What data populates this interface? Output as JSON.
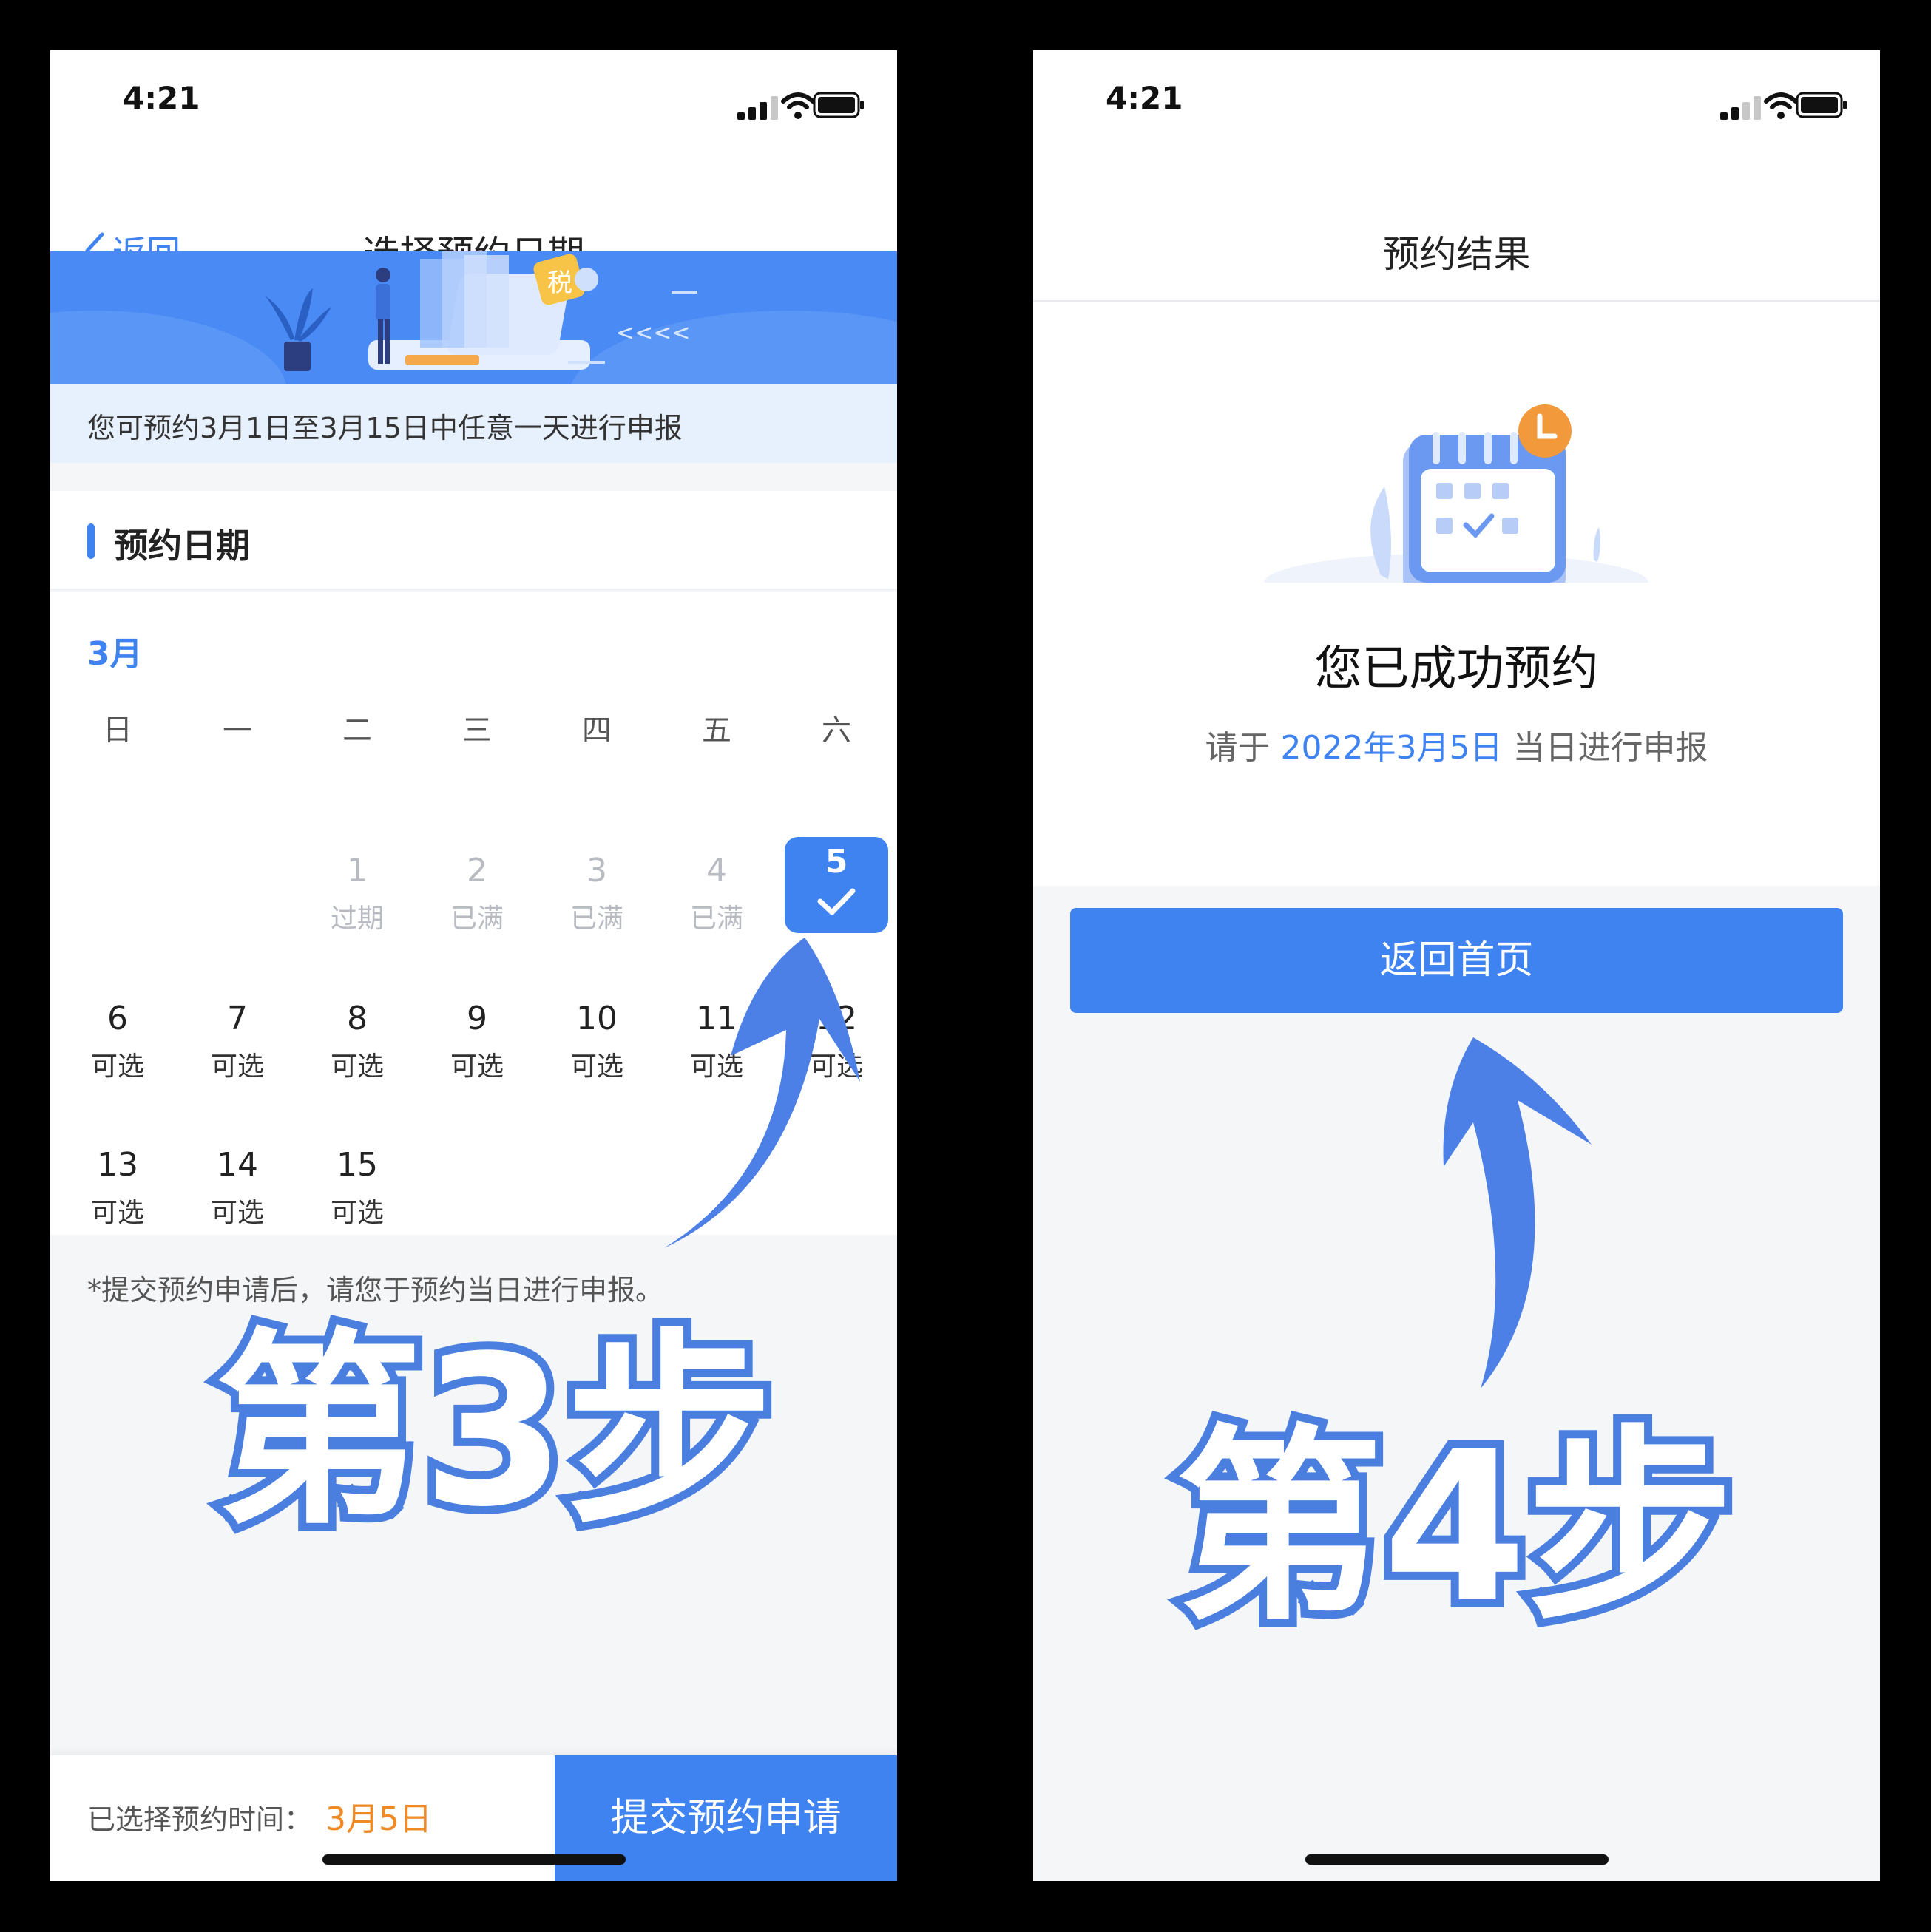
{
  "left_screen": {
    "status": {
      "time": "4:21"
    },
    "nav": {
      "back_label": "返回",
      "title": "选择预约日期"
    },
    "banner": {
      "badge": "税",
      "arrows": "<<<<"
    },
    "notice": "您可预约3月1日至3月15日中任意一天进行申报",
    "section_title": "预约日期",
    "calendar": {
      "month": "3月",
      "weekdays": [
        "日",
        "一",
        "二",
        "三",
        "四",
        "五",
        "六"
      ],
      "days": [
        {
          "num": "1",
          "status": "过期",
          "state": "disabled"
        },
        {
          "num": "2",
          "status": "已满",
          "state": "disabled"
        },
        {
          "num": "3",
          "status": "已满",
          "state": "disabled"
        },
        {
          "num": "4",
          "status": "已满",
          "state": "disabled"
        },
        {
          "num": "5",
          "status": "",
          "state": "selected"
        },
        {
          "num": "6",
          "status": "可选",
          "state": "available"
        },
        {
          "num": "7",
          "status": "可选",
          "state": "available"
        },
        {
          "num": "8",
          "status": "可选",
          "state": "available"
        },
        {
          "num": "9",
          "status": "可选",
          "state": "available"
        },
        {
          "num": "10",
          "status": "可选",
          "state": "available"
        },
        {
          "num": "11",
          "status": "可选",
          "state": "available"
        },
        {
          "num": "12",
          "status": "可选",
          "state": "available"
        },
        {
          "num": "13",
          "status": "可选",
          "state": "available"
        },
        {
          "num": "14",
          "status": "可选",
          "state": "available"
        },
        {
          "num": "15",
          "status": "可选",
          "state": "available"
        }
      ]
    },
    "footnote": "*提交预约申请后，请您于预约当日进行申报。",
    "step_label": "第3步",
    "bottom": {
      "selected_label": "已选择预约时间：",
      "selected_value": "3月5日",
      "submit_label": "提交预约申请"
    }
  },
  "right_screen": {
    "status": {
      "time": "4:21"
    },
    "nav": {
      "title": "预约结果"
    },
    "result": {
      "title": "您已成功预约",
      "sub_prefix": "请于",
      "sub_date": "2022年3月5日",
      "sub_suffix": "当日进行申报"
    },
    "home_button": "返回首页",
    "step_label": "第4步"
  },
  "colors": {
    "accent": "#3e83f0",
    "orange": "#f08a24",
    "step_outline": "#4a7fe0"
  }
}
